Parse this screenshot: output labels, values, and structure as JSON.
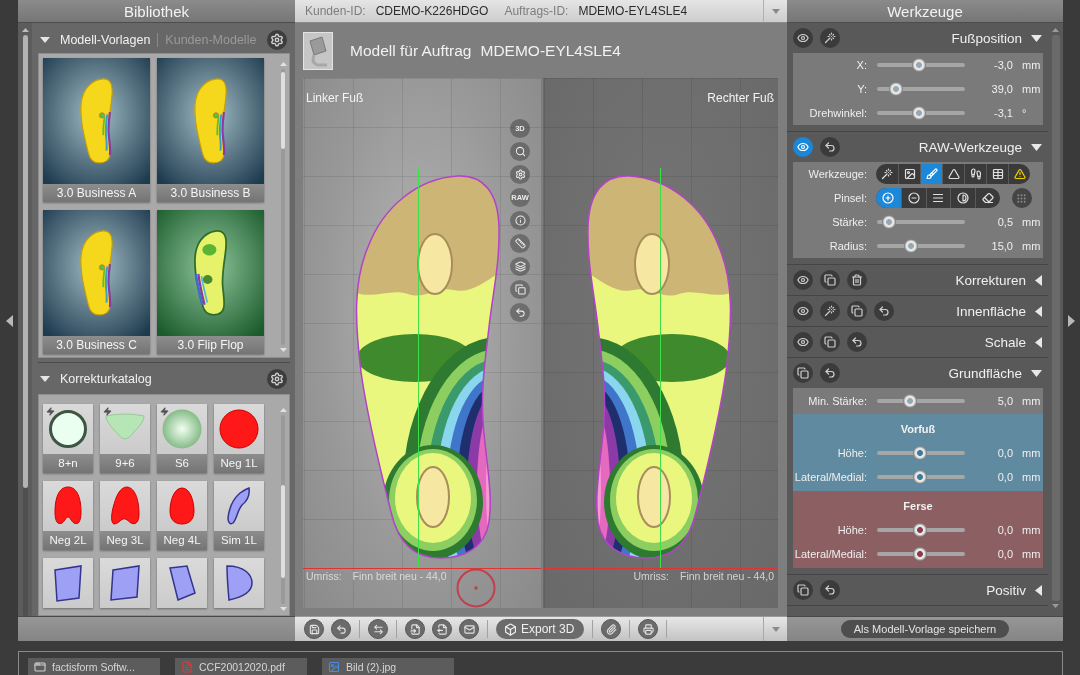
{
  "library": {
    "title": "Bibliothek",
    "templates": {
      "expanded": true,
      "tabs": [
        {
          "label": "Modell-Vorlagen",
          "selected": true
        },
        {
          "label": "Kunden-Modelle",
          "selected": false
        }
      ],
      "items": [
        {
          "label": "3.0 Business A",
          "kind": "contour"
        },
        {
          "label": "3.0 Business B",
          "kind": "contour"
        },
        {
          "label": "3.0 Business C",
          "kind": "contour"
        },
        {
          "label": "3.0 Flip Flop",
          "kind": "heatmap"
        }
      ]
    },
    "catalog": {
      "title": "Korrekturkatalog",
      "expanded": true,
      "items": [
        {
          "label": "8+n",
          "kind": "ring",
          "flash": true
        },
        {
          "label": "9+6",
          "kind": "cone",
          "flash": true
        },
        {
          "label": "S6",
          "kind": "sphere",
          "flash": true
        },
        {
          "label": "Neg 1L",
          "kind": "disc",
          "flash": false
        },
        {
          "label": "Neg 2L",
          "kind": "notch",
          "flash": false
        },
        {
          "label": "Neg 3L",
          "kind": "arch",
          "flash": false
        },
        {
          "label": "Neg 4L",
          "kind": "oval",
          "flash": false
        },
        {
          "label": "Sim 1L",
          "kind": "wedge",
          "flash": false
        },
        {
          "kind": "tile",
          "flash": false
        },
        {
          "kind": "slab",
          "flash": false
        },
        {
          "kind": "trapezoid",
          "flash": false
        },
        {
          "kind": "lobe",
          "flash": false
        }
      ]
    }
  },
  "order_bar": {
    "customer_label": "Kunden-ID:",
    "customer_id": "CDEMO-K226HDGO",
    "order_label": "Auftrags-ID:",
    "order_id": "MDEMO-EYL4SLE4"
  },
  "model": {
    "title": "Modell für Auftrag",
    "order_id": "MDEMO-EYL4SLE4",
    "views": [
      {
        "label": "Linker Fuß",
        "mirrored": false,
        "selected": true,
        "outline_label": "Umriss:",
        "outline_value": "Finn breit neu - 44,0"
      },
      {
        "label": "Rechter Fuß",
        "mirrored": true,
        "selected": false,
        "outline_label": "Umriss:",
        "outline_value": "Finn breit neu - 44,0"
      }
    ],
    "view_tools": [
      {
        "kind": "text",
        "label": "3D"
      },
      {
        "kind": "search"
      },
      {
        "kind": "settings"
      },
      {
        "kind": "text",
        "label": "RAW"
      },
      {
        "kind": "info"
      },
      {
        "kind": "measure"
      },
      {
        "kind": "layers"
      },
      {
        "kind": "copy"
      },
      {
        "kind": "undo"
      }
    ]
  },
  "toolbar": {
    "groups": [
      [
        {
          "kind": "save"
        },
        {
          "kind": "undo"
        }
      ],
      [
        {
          "kind": "swap"
        }
      ],
      [
        {
          "kind": "import"
        },
        {
          "kind": "export"
        },
        {
          "kind": "mail"
        }
      ],
      [
        {
          "kind": "export3d",
          "label": "Export 3D"
        }
      ],
      [
        {
          "kind": "attach"
        }
      ],
      [
        {
          "kind": "print"
        }
      ]
    ]
  },
  "tools": {
    "title": "Werkzeuge",
    "save_button": "Als Modell-Vorlage speichern",
    "sections": [
      {
        "title": "Fußposition",
        "expanded": true,
        "actions": [
          {
            "kind": "eye",
            "active": false
          },
          {
            "kind": "wand",
            "active": false
          }
        ],
        "rows": [
          {
            "kind": "slider",
            "label": "X:",
            "level": 0.47,
            "value": "-3,0",
            "unit": "mm"
          },
          {
            "kind": "slider",
            "label": "Y:",
            "level": 0.16,
            "value": "39,0",
            "unit": "mm"
          },
          {
            "kind": "slider",
            "label": "Drehwinkel:",
            "level": 0.47,
            "value": "-3,1",
            "unit": "°"
          }
        ]
      },
      {
        "title": "RAW-Werkzeuge",
        "expanded": true,
        "actions": [
          {
            "kind": "eye",
            "active": true
          },
          {
            "kind": "undo",
            "active": false
          }
        ],
        "rows": [
          {
            "kind": "tools",
            "label": "Werkzeuge:",
            "tools": [
              {
                "kind": "wand",
                "selected": false
              },
              {
                "kind": "heightmap",
                "selected": false
              },
              {
                "kind": "brush",
                "selected": true
              },
              {
                "kind": "cone",
                "selected": false
              },
              {
                "kind": "footprint",
                "selected": false
              },
              {
                "kind": "grid",
                "selected": false
              },
              {
                "kind": "warning",
                "selected": false
              }
            ]
          },
          {
            "kind": "tools",
            "label": "Pinsel:",
            "tools": [
              {
                "kind": "plus",
                "selected": true
              },
              {
                "kind": "minus",
                "selected": false
              },
              {
                "kind": "smooth",
                "selected": false
              },
              {
                "kind": "contrast",
                "selected": false
              },
              {
                "kind": "eraser",
                "selected": false
              }
            ],
            "extra": {
              "kind": "pattern"
            }
          },
          {
            "kind": "slider",
            "label": "Stärke:",
            "level": 0.07,
            "value": "0,5",
            "unit": "mm"
          },
          {
            "kind": "slider",
            "label": "Radius:",
            "level": 0.36,
            "value": "15,0",
            "unit": "mm"
          }
        ]
      },
      {
        "title": "Korrekturen",
        "expanded": false,
        "actions": [
          {
            "kind": "eye",
            "active": false
          },
          {
            "kind": "copy",
            "active": false
          },
          {
            "kind": "trash",
            "active": false
          }
        ]
      },
      {
        "title": "Innenfläche",
        "expanded": false,
        "actions": [
          {
            "kind": "eye",
            "active": false
          },
          {
            "kind": "wand",
            "active": false
          },
          {
            "kind": "copy",
            "active": false
          },
          {
            "kind": "undo",
            "active": false
          }
        ]
      },
      {
        "title": "Schale",
        "expanded": false,
        "actions": [
          {
            "kind": "eye",
            "active": false
          },
          {
            "kind": "copy",
            "active": false
          },
          {
            "kind": "undo",
            "active": false
          }
        ]
      },
      {
        "title": "Grundfläche",
        "expanded": true,
        "actions": [
          {
            "kind": "copy",
            "active": false
          },
          {
            "kind": "undo",
            "active": false
          }
        ],
        "rows": [
          {
            "kind": "slider",
            "label": "Min. Stärke:",
            "level": 0.35,
            "value": "5,0",
            "unit": "mm"
          }
        ],
        "groups": [
          {
            "kind": "forefoot",
            "title": "Vorfuß",
            "rows": [
              {
                "kind": "slider",
                "label": "Höhe:",
                "level": 0.49,
                "value": "0,0",
                "unit": "mm"
              },
              {
                "kind": "slider",
                "label": "Lateral/Medial:",
                "level": 0.49,
                "value": "0,0",
                "unit": "mm"
              }
            ]
          },
          {
            "kind": "heel",
            "title": "Ferse",
            "rows": [
              {
                "kind": "slider",
                "label": "Höhe:",
                "level": 0.49,
                "value": "0,0",
                "unit": "mm"
              },
              {
                "kind": "slider",
                "label": "Lateral/Medial:",
                "level": 0.49,
                "value": "0,0",
                "unit": "mm"
              }
            ]
          }
        ]
      },
      {
        "title": "Positiv",
        "expanded": false,
        "actions": [
          {
            "kind": "copy",
            "active": false
          },
          {
            "kind": "undo",
            "active": false
          }
        ]
      }
    ]
  },
  "downloads": [
    {
      "kind": "app",
      "label": "factisform Softw..."
    },
    {
      "kind": "pdf",
      "label": "CCF20012020.pdf"
    },
    {
      "kind": "image",
      "label": "Bild (2).jpg"
    }
  ]
}
